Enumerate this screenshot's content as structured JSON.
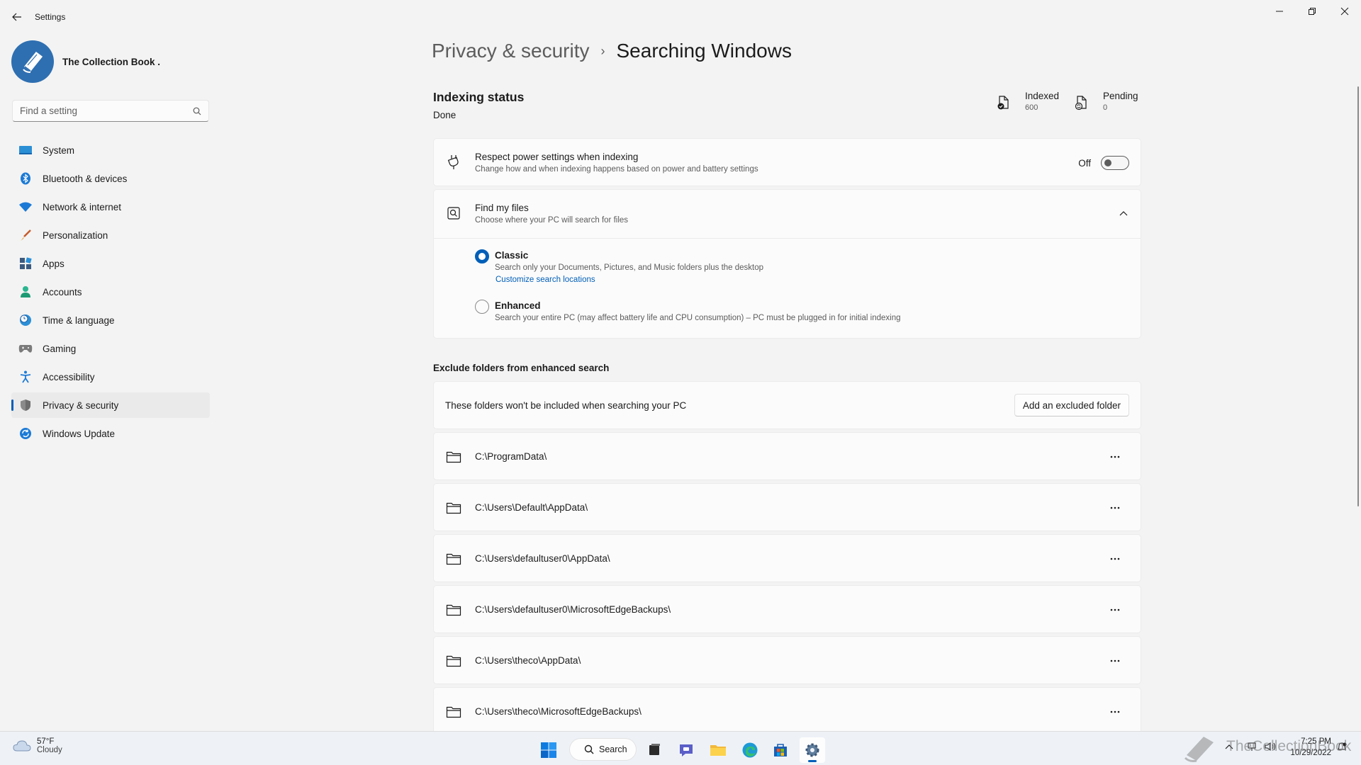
{
  "window": {
    "title": "Settings"
  },
  "profile": {
    "name": "The Collection Book ."
  },
  "search": {
    "placeholder": "Find a setting"
  },
  "nav": [
    {
      "label": "System"
    },
    {
      "label": "Bluetooth & devices"
    },
    {
      "label": "Network & internet"
    },
    {
      "label": "Personalization"
    },
    {
      "label": "Apps"
    },
    {
      "label": "Accounts"
    },
    {
      "label": "Time & language"
    },
    {
      "label": "Gaming"
    },
    {
      "label": "Accessibility"
    },
    {
      "label": "Privacy & security"
    },
    {
      "label": "Windows Update"
    }
  ],
  "breadcrumb": {
    "parent": "Privacy & security",
    "separator": "›",
    "current": "Searching Windows"
  },
  "indexing": {
    "title": "Indexing status",
    "state": "Done",
    "indexed_label": "Indexed",
    "indexed_value": "600",
    "pending_label": "Pending",
    "pending_value": "0"
  },
  "power": {
    "title": "Respect power settings when indexing",
    "desc": "Change how and when indexing happens based on power and battery settings",
    "toggle_label": "Off"
  },
  "find_files": {
    "title": "Find my files",
    "desc": "Choose where your PC will search for files",
    "classic_title": "Classic",
    "classic_desc": "Search only your Documents, Pictures, and Music folders plus the desktop",
    "classic_link": "Customize search locations",
    "enhanced_title": "Enhanced",
    "enhanced_desc": "Search your entire PC (may affect battery life and CPU consumption) – PC must be plugged in for initial indexing"
  },
  "exclude": {
    "heading": "Exclude folders from enhanced search",
    "info": "These folders won't be included when searching your PC",
    "button": "Add an excluded folder",
    "folders": [
      "C:\\ProgramData\\",
      "C:\\Users\\Default\\AppData\\",
      "C:\\Users\\defaultuser0\\AppData\\",
      "C:\\Users\\defaultuser0\\MicrosoftEdgeBackups\\",
      "C:\\Users\\theco\\AppData\\",
      "C:\\Users\\theco\\MicrosoftEdgeBackups\\"
    ]
  },
  "taskbar": {
    "temp": "57°F",
    "condition": "Cloudy",
    "search_label": "Search",
    "time": "7:25 PM",
    "date": "10/29/2022",
    "watermark": "TheCollectionBook"
  },
  "colors": {
    "accent": "#005fb8",
    "background": "#f3f3f3",
    "card": "#fbfbfb"
  }
}
